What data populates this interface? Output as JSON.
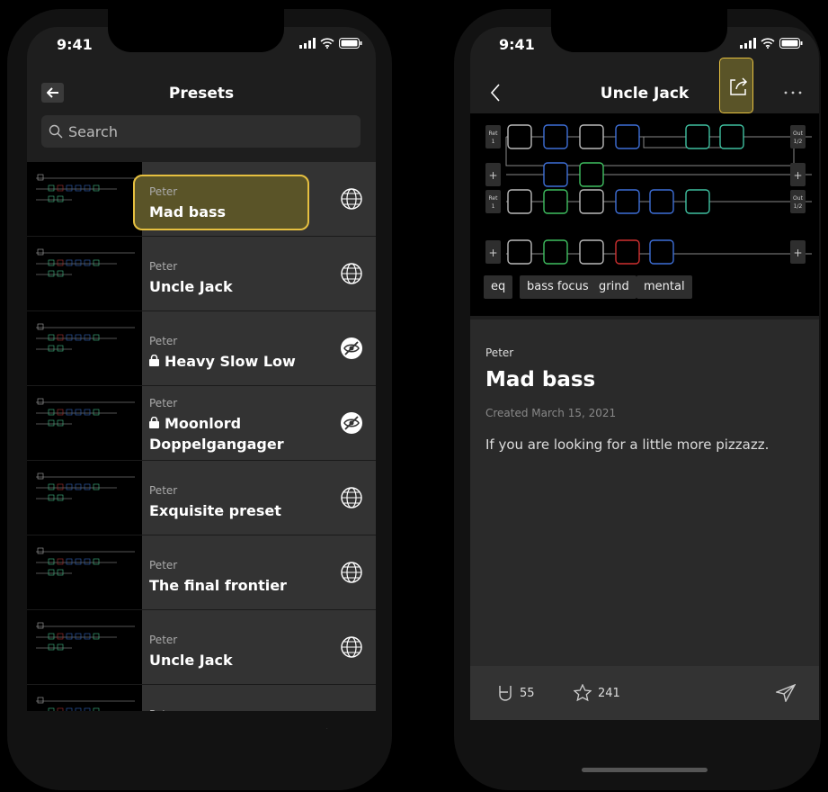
{
  "left": {
    "time": "9:41",
    "title": "Presets",
    "search_placeholder": "Search",
    "presets": [
      {
        "author": "Peter",
        "name": "Mad bass",
        "locked": false,
        "visibility": "globe-icon"
      },
      {
        "author": "Peter",
        "name": "Uncle Jack",
        "locked": false,
        "visibility": "globe-icon"
      },
      {
        "author": "Peter",
        "name": "Heavy Slow Low",
        "locked": true,
        "visibility": "hidden-icon"
      },
      {
        "author": "Peter",
        "name": "Moonlord Doppelgangager",
        "locked": true,
        "visibility": "hidden-icon"
      },
      {
        "author": "Peter",
        "name": "Exquisite preset",
        "locked": false,
        "visibility": "globe-icon"
      },
      {
        "author": "Peter",
        "name": "The final frontier",
        "locked": false,
        "visibility": "globe-icon"
      },
      {
        "author": "Peter",
        "name": "Uncle Jack",
        "locked": false,
        "visibility": "globe-icon"
      },
      {
        "author": "Peter",
        "name": "",
        "locked": false,
        "visibility": "globe-icon"
      }
    ],
    "tabs": [
      "profile-icon",
      "search-icon",
      "lightning-icon"
    ]
  },
  "right": {
    "time": "9:41",
    "title": "Uncle Jack",
    "diagram_labels": {
      "ret1": "Ret",
      "ret1_num": "1",
      "out1": "Out",
      "out1_num": "1/2",
      "ret2": "Ret",
      "ret2_num": "1",
      "out2": "Out",
      "out2_num": "1/2",
      "plus": "+"
    },
    "tags": [
      "eq",
      "bass focus",
      "grind",
      "mental"
    ],
    "author": "Peter",
    "preset_name": "Mad bass",
    "created": "Created March 15, 2021",
    "description": "If you are looking for a little more pizzazz.",
    "likes": "55",
    "stars": "241",
    "accent": "#e6c040"
  }
}
